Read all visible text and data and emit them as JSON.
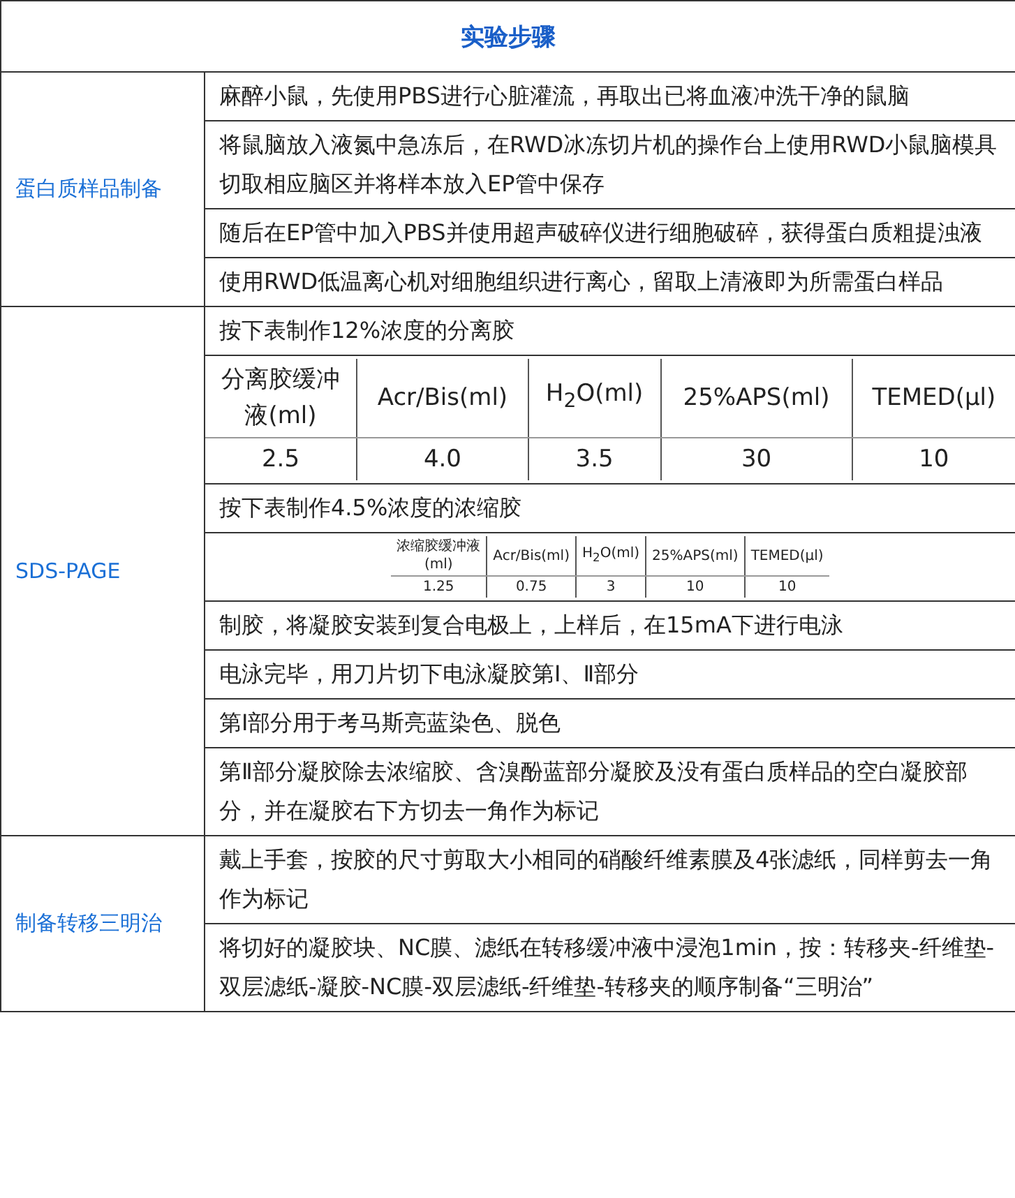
{
  "title": "实验步骤",
  "sections": [
    {
      "name": "蛋白质样品制备",
      "steps": [
        {
          "kind": "text",
          "text": "麻醉小鼠，先使用PBS进行心脏灌流，再取出已将血液冲洗干净的鼠脑"
        },
        {
          "kind": "text",
          "text": "将鼠脑放入液氮中急冻后，在RWD冰冻切片机的操作台上使用RWD小鼠脑模具切取相应脑区并将样本放入EP管中保存"
        },
        {
          "kind": "text",
          "text": "随后在EP管中加入PBS并使用超声破碎仪进行细胞破碎，获得蛋白质粗提浊液"
        },
        {
          "kind": "text",
          "text": "使用RWD低温离心机对细胞组织进行离心，留取上清液即为所需蛋白样品"
        }
      ]
    },
    {
      "name": "SDS-PAGE",
      "steps": [
        {
          "kind": "text",
          "text": "按下表制作12%浓度的分离胶"
        },
        {
          "kind": "large_table",
          "headers": [
            "分离胶缓冲液(ml)",
            "Acr/Bis(ml)",
            "H$_{2}$O(ml)",
            "25%APS(ml)",
            "TEMED(μl)"
          ],
          "values": [
            "2.5",
            "4.0",
            "3.5",
            "30",
            "10"
          ]
        },
        {
          "kind": "text",
          "text": "按下表制作4.5%浓度的浓缩胶"
        },
        {
          "kind": "small_table",
          "headers": [
            "浓缩胶缓冲液(ml)",
            "Acr/Bis(ml)",
            "H$_{2}$O(ml)",
            "25%APS(ml)",
            "TEMED(μl)"
          ],
          "values": [
            "1.25",
            "0.75",
            "3",
            "10",
            "10"
          ]
        },
        {
          "kind": "text",
          "text": "制胶，将凝胶安装到复合电极上，上样后，在15mA下进行电泳"
        },
        {
          "kind": "text",
          "text": "电泳完毕，用刀片切下电泳凝胶第Ⅰ、Ⅱ部分"
        },
        {
          "kind": "text",
          "text": "第Ⅰ部分用于考马斯亮蓝染色、脱色"
        },
        {
          "kind": "text",
          "text": "第Ⅱ部分凝胶除去浓缩胶、含溴酚蓝部分凝胶及没有蛋白质样品的空白凝胶部分，并在凝胶右下方切去一角作为标记"
        }
      ]
    },
    {
      "name": "制备转移三明治",
      "steps": [
        {
          "kind": "text",
          "text": "戴上手套，按胶的尺寸剪取大小相同的硝酸纤维素膜及4张滤纸，同样剪去一角作为标记"
        },
        {
          "kind": "text",
          "text": "将切好的凝胶块、NC膜、滤纸在转移缓冲液中浸泡1min，按：转移夹-纤维垫-双层滤纸-凝胶-NC膜-双层滤纸-纤维垫-转移夹的顺序制备“三明治”"
        }
      ]
    }
  ]
}
